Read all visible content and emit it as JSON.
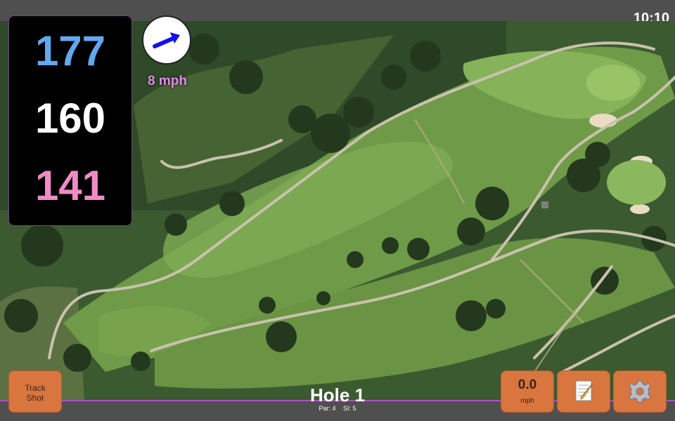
{
  "status": {
    "time": "10:10"
  },
  "distances": {
    "back": "177",
    "center": "160",
    "front": "141"
  },
  "wind": {
    "speed": "8 mph",
    "arrow_icon": "wind-direction-arrow-icon",
    "arrow_color": "#1010f0"
  },
  "hole": {
    "title": "Hole 1",
    "par": "Par: 4",
    "si": "SI: 5"
  },
  "buttons": {
    "track_shot": "Track\nShot",
    "speed_value": "0.0",
    "speed_unit": "mph",
    "notes_icon": "notepad-pencil-icon",
    "settings_icon": "gear-icon"
  },
  "colors": {
    "button": "#d9753f",
    "accent_border": "#b04fc6",
    "back_distance": "#62a8ef",
    "center_distance": "#ffffff",
    "front_distance": "#f08bc5",
    "wind_text": "#e48bea"
  }
}
